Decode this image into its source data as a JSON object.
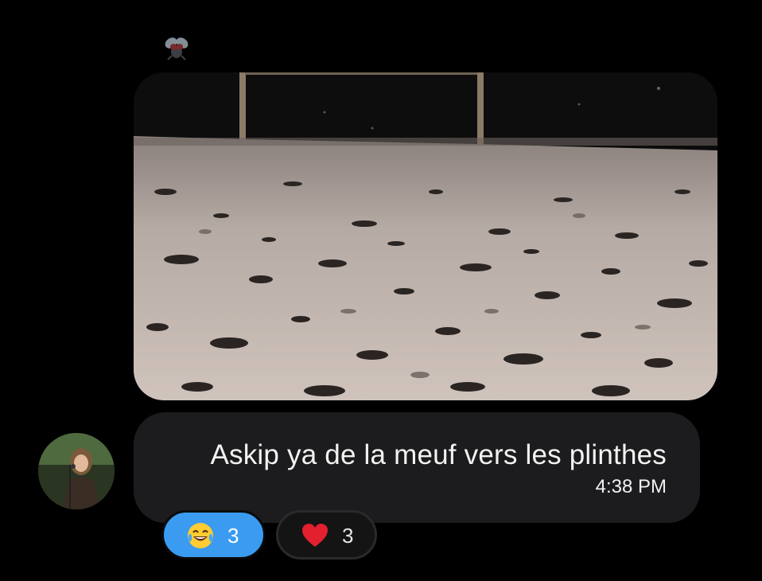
{
  "message": {
    "text": "Askip ya de la meuf vers les plinthes",
    "time": "4:38 PM",
    "icons": {
      "above_image": "fly-icon",
      "avatar": "user-avatar"
    }
  },
  "reactions": [
    {
      "icon": "laughing-crying-emoji",
      "count": "3",
      "selected": true,
      "color": "#3a9bf1"
    },
    {
      "icon": "red-heart-emoji",
      "count": "3",
      "selected": false,
      "color": "#141414"
    }
  ],
  "colors": {
    "background": "#000000",
    "bubble": "#1c1c1e",
    "accent": "#3a9bf1"
  }
}
